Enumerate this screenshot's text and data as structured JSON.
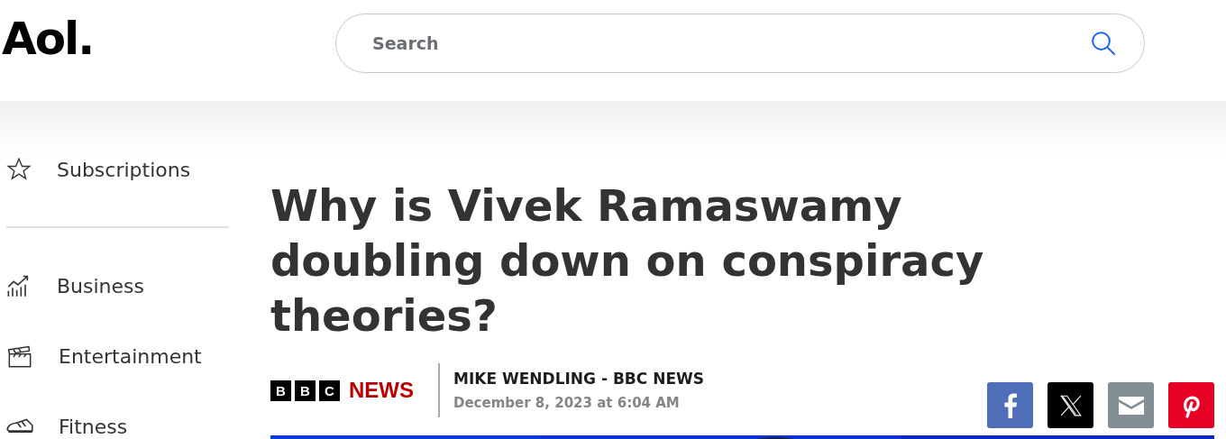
{
  "header": {
    "logo": "Aol.",
    "search": {
      "placeholder": "Search"
    }
  },
  "sidebar": {
    "items": [
      {
        "label": "Subscriptions",
        "kind": "star"
      },
      {
        "label": "Business",
        "kind": "chart"
      },
      {
        "label": "Entertainment",
        "kind": "clapper"
      },
      {
        "label": "Fitness",
        "kind": "shoe"
      }
    ]
  },
  "article": {
    "title": "Why is Vivek Ramaswamy doubling down on conspiracy theories?",
    "source": {
      "letters": [
        "B",
        "B",
        "C"
      ],
      "word": "NEWS"
    },
    "byline": "MIKE WENDLING - BBC NEWS",
    "date": "December 8, 2023 at 6:04 AM",
    "share": [
      {
        "kind": "facebook",
        "color": "#4f6fb8"
      },
      {
        "kind": "x",
        "color": "#000000"
      },
      {
        "kind": "email",
        "color": "#838e95"
      },
      {
        "kind": "pinterest",
        "color": "#e60023"
      }
    ]
  }
}
